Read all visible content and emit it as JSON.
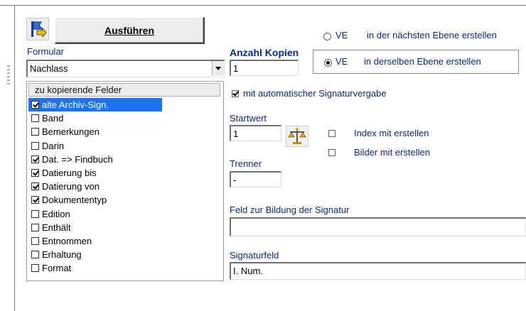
{
  "toolbar": {
    "run_label": "Ausführen",
    "run_icon": "flag-arrow-icon"
  },
  "form": {
    "formular_label": "Formular",
    "formular_value": "Nachlass",
    "list_header": "zu kopierende Felder",
    "fields": [
      {
        "label": "alte Archiv-Sign.",
        "checked": true,
        "selected": true
      },
      {
        "label": "Band",
        "checked": false,
        "selected": false
      },
      {
        "label": "Bemerkungen",
        "checked": false,
        "selected": false
      },
      {
        "label": "Darin",
        "checked": false,
        "selected": false
      },
      {
        "label": "Dat. => Findbuch",
        "checked": true,
        "selected": false
      },
      {
        "label": "Datierung bis",
        "checked": true,
        "selected": false
      },
      {
        "label": "Datierung von",
        "checked": true,
        "selected": false
      },
      {
        "label": "Dokumententyp",
        "checked": true,
        "selected": false
      },
      {
        "label": "Edition",
        "checked": false,
        "selected": false
      },
      {
        "label": "Enthält",
        "checked": false,
        "selected": false
      },
      {
        "label": "Entnommen",
        "checked": false,
        "selected": false
      },
      {
        "label": "Erhaltung",
        "checked": false,
        "selected": false
      },
      {
        "label": "Format",
        "checked": false,
        "selected": false
      }
    ]
  },
  "copies": {
    "label": "Anzahl Kopien",
    "value": "1"
  },
  "level": {
    "option1_prefix": "VE",
    "option1_label": "in der nächsten Ebene erstellen",
    "option1_selected": false,
    "option2_prefix": "VE",
    "option2_label": "in derselben Ebene erstellen",
    "option2_selected": true
  },
  "signature": {
    "auto_label": "mit automatischer Signaturvergabe",
    "auto_checked": true,
    "start_label": "Startwert",
    "start_value": "1",
    "separator_label": "Trenner",
    "separator_value": "-",
    "build_field_label": "Feld zur Bildung der Signatur",
    "build_field_value": "",
    "sig_field_label": "Signaturfeld",
    "sig_field_value": "I. Num.",
    "scale_icon": "balance-scale-icon"
  },
  "options": {
    "index_label": "Index mit erstellen",
    "index_checked": false,
    "images_label": "Bilder mit erstellen",
    "images_checked": false
  }
}
